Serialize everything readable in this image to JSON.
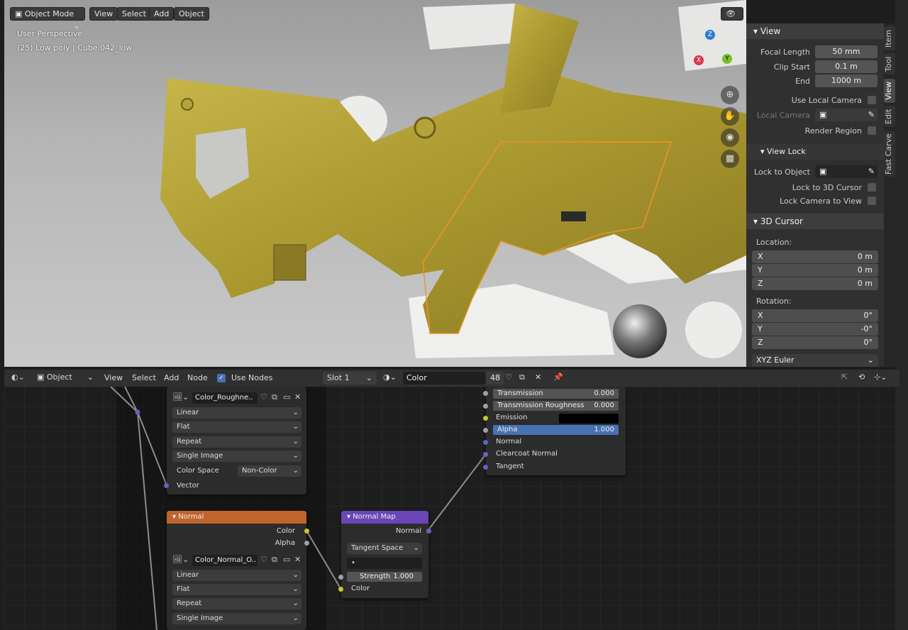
{
  "viewport": {
    "mode": "Object Mode",
    "menus": [
      "View",
      "Select",
      "Add",
      "Object"
    ],
    "info_line1": "User Perspective",
    "info_line2": "(25) Low poly | Cube.042_low",
    "gizmo": {
      "z": "Z",
      "y": "Y",
      "x": "X"
    }
  },
  "npanel": {
    "view_header": "View",
    "focal_length_label": "Focal Length",
    "focal_length": "50 mm",
    "clip_start_label": "Clip Start",
    "clip_start": "0.1 m",
    "end_label": "End",
    "end": "1000 m",
    "use_local_camera": "Use Local Camera",
    "local_camera": "Local Camera",
    "render_region": "Render Region",
    "view_lock_header": "View Lock",
    "lock_to_object": "Lock to Object",
    "lock_to_cursor": "Lock to 3D Cursor",
    "lock_camera": "Lock Camera to View",
    "cursor_header": "3D Cursor",
    "location_label": "Location:",
    "loc": [
      {
        "axis": "X",
        "value": "0 m"
      },
      {
        "axis": "Y",
        "value": "0 m"
      },
      {
        "axis": "Z",
        "value": "0 m"
      }
    ],
    "rotation_label": "Rotation:",
    "rot": [
      {
        "axis": "X",
        "value": "0°"
      },
      {
        "axis": "Y",
        "value": "-0°"
      },
      {
        "axis": "Z",
        "value": "0°"
      }
    ],
    "rotation_mode": "XYZ Euler"
  },
  "tabs": [
    "Item",
    "Tool",
    "View",
    "Edit",
    "Fast Carve"
  ],
  "node_editor_header": {
    "object": "Object",
    "menus": [
      "View",
      "Select",
      "Add",
      "Node"
    ],
    "use_nodes": "Use Nodes",
    "slot": "Slot 1",
    "material": "Color",
    "users": "48"
  },
  "image_node_top": {
    "image": "Color_Roughne..",
    "interp": "Linear",
    "proj": "Flat",
    "ext": "Repeat",
    "source": "Single Image",
    "colorspace_label": "Color Space",
    "colorspace": "Non-Color",
    "vector": "Vector"
  },
  "normal_node": {
    "title": "Normal",
    "out_color": "Color",
    "out_alpha": "Alpha",
    "image": "Color_Normal_O..",
    "interp": "Linear",
    "proj": "Flat",
    "ext": "Repeat",
    "source": "Single Image"
  },
  "normal_map": {
    "title": "Normal Map",
    "out": "Normal",
    "space": "Tangent Space",
    "uv": "•",
    "strength_label": "Strength",
    "strength": "1.000",
    "in_color": "Color"
  },
  "bsdf": {
    "transmission_label": "Transmission",
    "transmission": "0.000",
    "trans_rough_label": "Transmission Roughness",
    "trans_rough": "0.000",
    "emission": "Emission",
    "alpha_label": "Alpha",
    "alpha": "1.000",
    "normal": "Normal",
    "clearcoat_normal": "Clearcoat Normal",
    "tangent": "Tangent"
  }
}
